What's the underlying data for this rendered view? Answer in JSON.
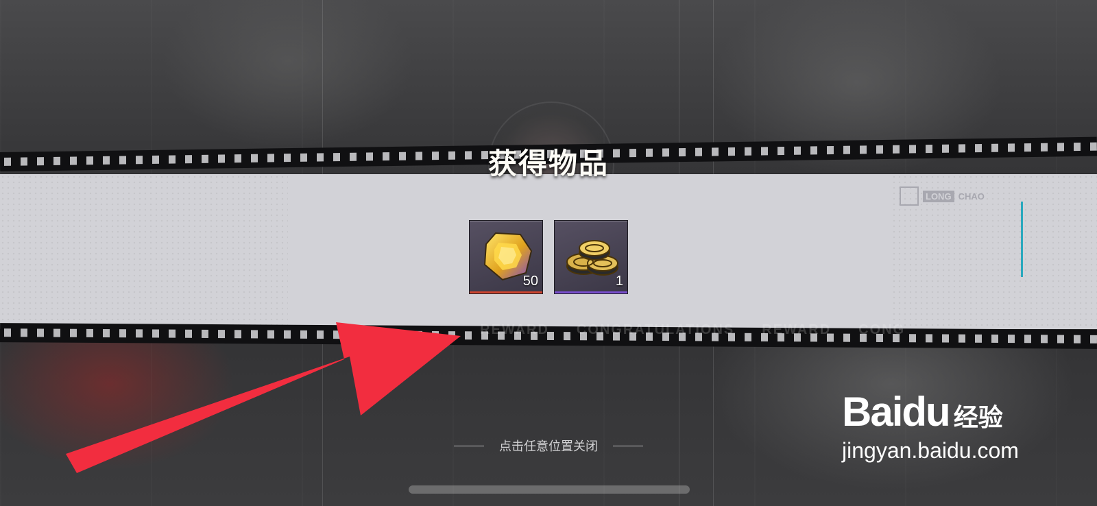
{
  "dialog": {
    "title": "获得物品",
    "close_hint": "点击任意位置关闭"
  },
  "items": [
    {
      "name": "gem",
      "count": "50",
      "rarity_color": "#d0452f"
    },
    {
      "name": "coins",
      "count": "1",
      "rarity_color": "#7a4fd0"
    }
  ],
  "brand": {
    "long": "LONG",
    "chao": "CHAO"
  },
  "background_text": [
    "REWARD",
    "CONGRATULATIONS",
    "REWARD",
    "CONG"
  ],
  "watermark": {
    "logo": "Bai",
    "logo_du": "du",
    "jingyan": "经验",
    "url": "jingyan.baidu.com"
  },
  "colors": {
    "arrow": "#f22d3f",
    "banner": "#d2d2d7",
    "accent_cyan": "#2aa8bd"
  }
}
